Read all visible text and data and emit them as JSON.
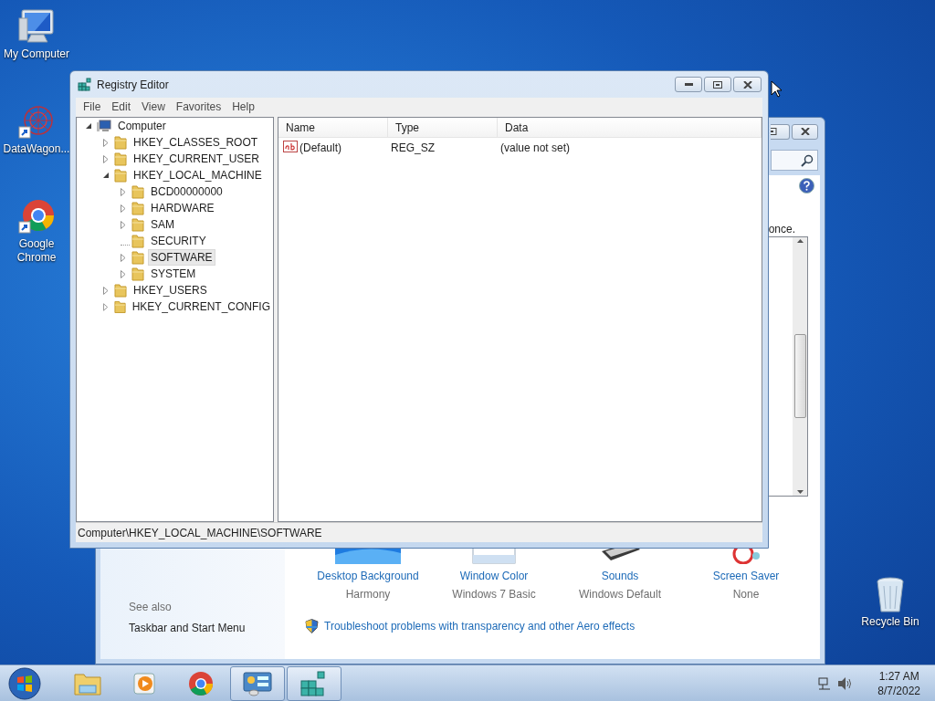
{
  "desktop_icons": [
    {
      "label": "My Computer",
      "kind": "computer"
    },
    {
      "label": "DataWagon...",
      "kind": "web"
    },
    {
      "label": "Google Chrome",
      "kind": "chrome"
    },
    {
      "label": "Recycle Bin",
      "kind": "recycle"
    }
  ],
  "personalization": {
    "partial_text": "once.",
    "see_also": {
      "heading": "See also",
      "links": [
        "Taskbar and Start Menu"
      ]
    },
    "settings": [
      {
        "label": "Desktop Background",
        "value": "Harmony",
        "kind": "background"
      },
      {
        "label": "Window Color",
        "value": "Windows 7 Basic",
        "kind": "color"
      },
      {
        "label": "Sounds",
        "value": "Windows Default",
        "kind": "sounds"
      },
      {
        "label": "Screen Saver",
        "value": "None",
        "kind": "saver"
      }
    ],
    "troubleshoot_link": "Troubleshoot problems with transparency and other Aero effects"
  },
  "registry_editor": {
    "title": "Registry Editor",
    "menu": [
      "File",
      "Edit",
      "View",
      "Favorites",
      "Help"
    ],
    "tree": {
      "label": "Computer",
      "expandable": true,
      "expanded": true,
      "selected": false,
      "children": [
        {
          "label": "HKEY_CLASSES_ROOT",
          "expandable": true,
          "expanded": false,
          "selected": false
        },
        {
          "label": "HKEY_CURRENT_USER",
          "expandable": true,
          "expanded": false,
          "selected": false
        },
        {
          "label": "HKEY_LOCAL_MACHINE",
          "expandable": true,
          "expanded": true,
          "selected": false,
          "children": [
            {
              "label": "BCD00000000",
              "expandable": true,
              "expanded": false,
              "selected": false
            },
            {
              "label": "HARDWARE",
              "expandable": true,
              "expanded": false,
              "selected": false
            },
            {
              "label": "SAM",
              "expandable": true,
              "expanded": false,
              "selected": false
            },
            {
              "label": "SECURITY",
              "expandable": false,
              "expanded": false,
              "selected": false
            },
            {
              "label": "SOFTWARE",
              "expandable": true,
              "expanded": false,
              "selected": true
            },
            {
              "label": "SYSTEM",
              "expandable": true,
              "expanded": false,
              "selected": false
            }
          ]
        },
        {
          "label": "HKEY_USERS",
          "expandable": true,
          "expanded": false,
          "selected": false
        },
        {
          "label": "HKEY_CURRENT_CONFIG",
          "expandable": true,
          "expanded": false,
          "selected": false
        }
      ]
    },
    "columns": [
      "Name",
      "Type",
      "Data"
    ],
    "rows": [
      {
        "name": "(Default)",
        "type": "REG_SZ",
        "data": "(value not set)"
      }
    ],
    "status": "Computer\\HKEY_LOCAL_MACHINE\\SOFTWARE"
  },
  "taskbar": {
    "apps": [
      {
        "kind": "explorer",
        "running": false
      },
      {
        "kind": "media",
        "running": false
      },
      {
        "kind": "chrome",
        "running": false
      },
      {
        "kind": "controlpanel",
        "running": true
      },
      {
        "kind": "regedit",
        "running": true
      }
    ],
    "clock": {
      "time": "1:27 AM",
      "date": "8/7/2022"
    }
  }
}
